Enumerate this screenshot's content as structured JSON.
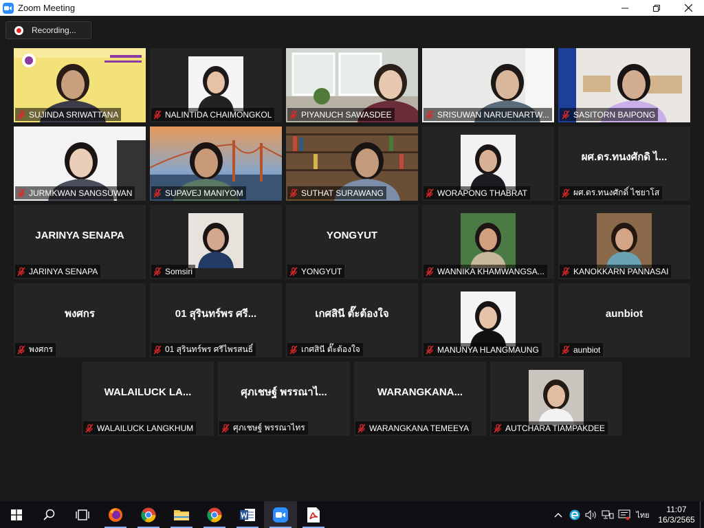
{
  "window": {
    "title": "Zoom Meeting"
  },
  "recording": {
    "label": "Recording..."
  },
  "colors": {
    "active_speaker": "#f5e45c",
    "muted_icon": "#e02828",
    "tile_bg": "#242424",
    "zoom_blue": "#2d8cff"
  },
  "participants": [
    {
      "display": "SUJINDA SRIWATTANA",
      "center": "",
      "video": true,
      "active": true
    },
    {
      "display": "NALINTIDA CHAIMONGKOL",
      "center": "",
      "video": true
    },
    {
      "display": "PIYANUCH SAWASDEE",
      "center": "",
      "video": true
    },
    {
      "display": "SRISUWAN NARUENARTW...",
      "center": "",
      "video": true
    },
    {
      "display": "SASITORN BAIPONG",
      "center": "",
      "video": true
    },
    {
      "display": "JURMKWAN SANGSUWAN",
      "center": "",
      "video": true
    },
    {
      "display": "SUPAVEJ MANIYOM",
      "center": "",
      "video": true
    },
    {
      "display": "SUTHAT SURAWANG",
      "center": "",
      "video": true
    },
    {
      "display": "WORAPONG THABRAT",
      "center": "",
      "video": true
    },
    {
      "display": "ผศ.ดร.ทนงศักดิ์ ไชยาโส",
      "center": "ผศ.ดร.ทนงศักดิ ไ...",
      "video": false
    },
    {
      "display": "JARINYA SENAPA",
      "center": "JARINYA SENAPA",
      "video": false
    },
    {
      "display": "Somsiri",
      "center": "",
      "video": true
    },
    {
      "display": "YONGYUT",
      "center": "YONGYUT",
      "video": false
    },
    {
      "display": "WANNIKA KHAMWANGSA...",
      "center": "",
      "video": true
    },
    {
      "display": "KANOKKARN PANNASAI",
      "center": "",
      "video": true
    },
    {
      "display": "พงศกร",
      "center": "พงศกร",
      "video": false
    },
    {
      "display": "01 สุรินทร์พร ศรีไพรสนธิ์",
      "center": "01 สุรินทร์พร ศรี...",
      "video": false
    },
    {
      "display": "เกศสินี ตั๊ะต้องใจ",
      "center": "เกศสินี ตั๊ะต้องใจ",
      "video": false
    },
    {
      "display": "MANUNYA HLANGMAUNG",
      "center": "",
      "video": true
    },
    {
      "display": "aunbiot",
      "center": "aunbiot",
      "video": false
    },
    {
      "display": "WALAILUCK LANGKHUM",
      "center": "WALAILUCK LA...",
      "video": false
    },
    {
      "display": "ศุภเชษฐ์ พรรณาไทร",
      "center": "ศุภเชษฐ์ พรรณาไ...",
      "video": false
    },
    {
      "display": "WARANGKANA TEMEEYA",
      "center": "WARANGKANA...",
      "video": false
    },
    {
      "display": "AUTCHARA TIAMPAKDEE",
      "center": "",
      "video": true
    }
  ],
  "taskbar": {
    "apps": [
      "windows-start",
      "search",
      "task-view",
      "firefox",
      "chrome",
      "file-explorer",
      "chrome",
      "word",
      "zoom",
      "acrobat"
    ],
    "tray": {
      "language": "ไทย",
      "time": "11:07",
      "date": "16/3/2565"
    }
  }
}
